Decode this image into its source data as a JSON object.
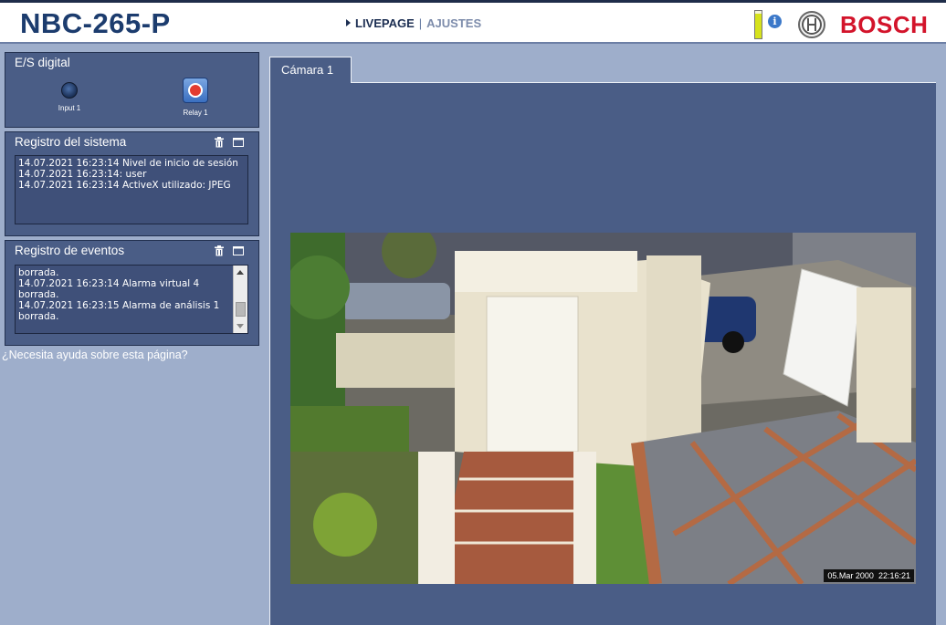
{
  "header": {
    "model": "NBC-265-P",
    "nav_live": "LIVEPAGE",
    "nav_sep": "|",
    "nav_settings": "AJUSTES",
    "brand": "BOSCH",
    "info_glyph": "i",
    "signal_level": 0.9
  },
  "digital_io": {
    "title": "E/S digital",
    "input_label": "Input 1",
    "relay_label": "Relay 1"
  },
  "system_log": {
    "title": "Registro del sistema",
    "lines": [
      "14.07.2021 16:23:14 Nivel de inicio de sesión",
      "14.07.2021 16:23:14: user",
      "14.07.2021 16:23:14 ActiveX utilizado: JPEG"
    ]
  },
  "event_log": {
    "title": "Registro de eventos",
    "lines": [
      "borrada.",
      "14.07.2021 16:23:14 Alarma virtual 4",
      "borrada.",
      "14.07.2021 16:23:15 Alarma de análisis 1",
      "borrada."
    ]
  },
  "help_link": "¿Necesita ayuda sobre esta página?",
  "camera": {
    "tab_label": "Cámara 1",
    "osd_date": "05.Mar 2000",
    "osd_time": "22:16:21"
  },
  "colors": {
    "panel": "#4a5d86",
    "page_bg": "#9eaecb",
    "brand_red": "#d3142b",
    "title_blue": "#1c3c6e"
  }
}
